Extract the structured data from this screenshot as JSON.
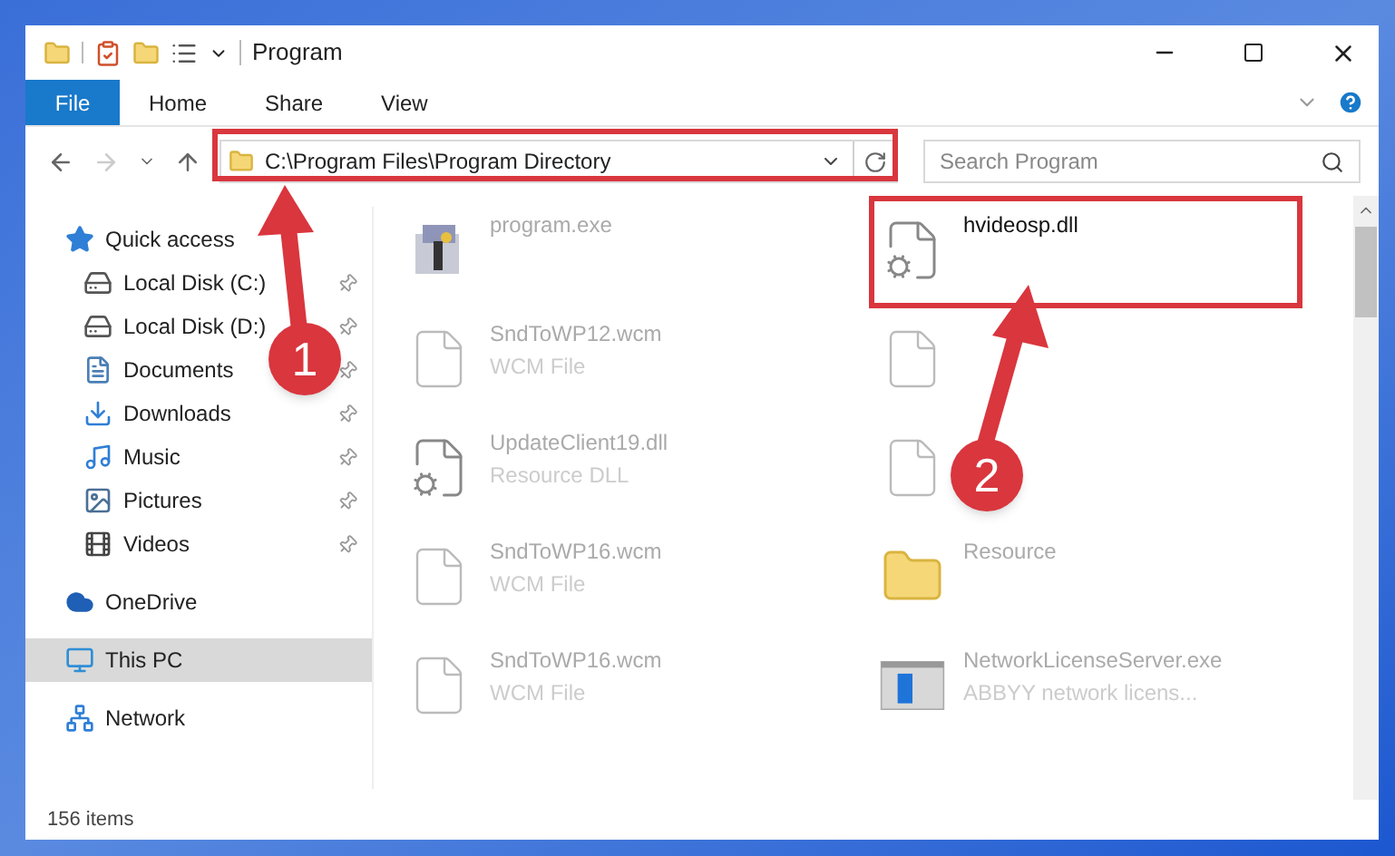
{
  "window": {
    "title": "Program"
  },
  "ribbon": {
    "file_button": "File",
    "tabs": [
      "Home",
      "Share",
      "View"
    ]
  },
  "address": {
    "path": "C:\\Program Files\\Program Directory"
  },
  "search": {
    "placeholder": "Search Program"
  },
  "sidebar": {
    "items": [
      {
        "label": "Quick access",
        "kind": "quick",
        "selected": false,
        "children": [
          {
            "label": "Local Disk (C:)",
            "kind": "system-drive",
            "pinned": true
          },
          {
            "label": "Local Disk (D:)",
            "kind": "drive",
            "pinned": true
          },
          {
            "label": "Documents",
            "kind": "documents",
            "pinned": true
          },
          {
            "label": "Downloads",
            "kind": "downloads",
            "pinned": true
          },
          {
            "label": "Music",
            "kind": "music",
            "pinned": true
          },
          {
            "label": "Pictures",
            "kind": "pictures",
            "pinned": true
          },
          {
            "label": "Videos",
            "kind": "videos",
            "pinned": true
          }
        ]
      },
      {
        "label": "OneDrive",
        "kind": "cloud",
        "selected": false
      },
      {
        "label": "This PC",
        "kind": "pc",
        "selected": true
      },
      {
        "label": "Network",
        "kind": "network",
        "selected": false
      }
    ]
  },
  "files": [
    {
      "name": "program.exe",
      "kind": "exe",
      "highlighted": false
    },
    {
      "name": "hvideosp.dll",
      "kind": "dll",
      "highlighted": true
    },
    {
      "name": "SndToWP12.wcm",
      "type": "WCM File",
      "kind": "blank",
      "highlighted": false
    },
    {
      "kind": "blank"
    },
    {
      "name": "UpdateClient19.dll",
      "type": "Resource DLL",
      "kind": "dll",
      "highlighted": false
    },
    {
      "kind": "blank"
    },
    {
      "name": "SndToWP16.wcm",
      "type": "WCM File",
      "kind": "blank",
      "highlighted": false
    },
    {
      "name": "Resource",
      "kind": "folder",
      "highlighted": false
    },
    {
      "name": "SndToWP16.wcm",
      "type": "WCM File",
      "kind": "blank",
      "highlighted": false
    },
    {
      "name": "NetworkLicenseServer.exe",
      "type": "ABBYY network licens...",
      "kind": "app",
      "highlighted": false
    }
  ],
  "status_bar": {
    "count": "156 items"
  },
  "annotations": [
    {
      "label": "1"
    },
    {
      "label": "2"
    }
  ]
}
